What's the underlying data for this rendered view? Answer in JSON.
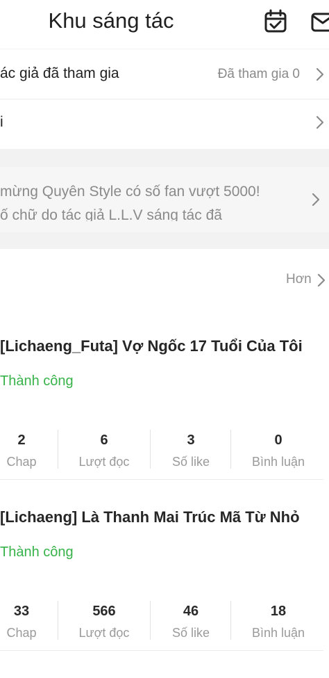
{
  "header": {
    "title": "Khu sáng tác",
    "icons": [
      "calendar-check-icon",
      "mail-icon"
    ]
  },
  "menu": {
    "rows": [
      {
        "label": "ác giả đã tham gia",
        "value": "Đã tham gia 0"
      },
      {
        "label": "i",
        "value": ""
      }
    ]
  },
  "announcement": {
    "line1": "mừng Quyên Style có số fan vượt 5000!",
    "line2": "ố chữ do tác giả L.L.V sáng tác đã"
  },
  "works": {
    "more_label": "Hơn",
    "stat_labels": [
      "Chap",
      "Lượt đọc",
      "Số like",
      "Bình luận"
    ],
    "items": [
      {
        "title": "[Lichaeng_Futa] Vợ Ngốc 17 Tuổi Của Tôi",
        "status": "Thành công",
        "stats": [
          "2",
          "6",
          "3",
          "0"
        ]
      },
      {
        "title": "[Lichaeng] Là Thanh Mai Trúc Mã Từ Nhỏ",
        "status": "Thành công",
        "stats": [
          "33",
          "566",
          "46",
          "18"
        ]
      }
    ]
  },
  "colors": {
    "success": "#37b34a",
    "muted": "#8a8a8a",
    "band": "#f2f2f2"
  }
}
